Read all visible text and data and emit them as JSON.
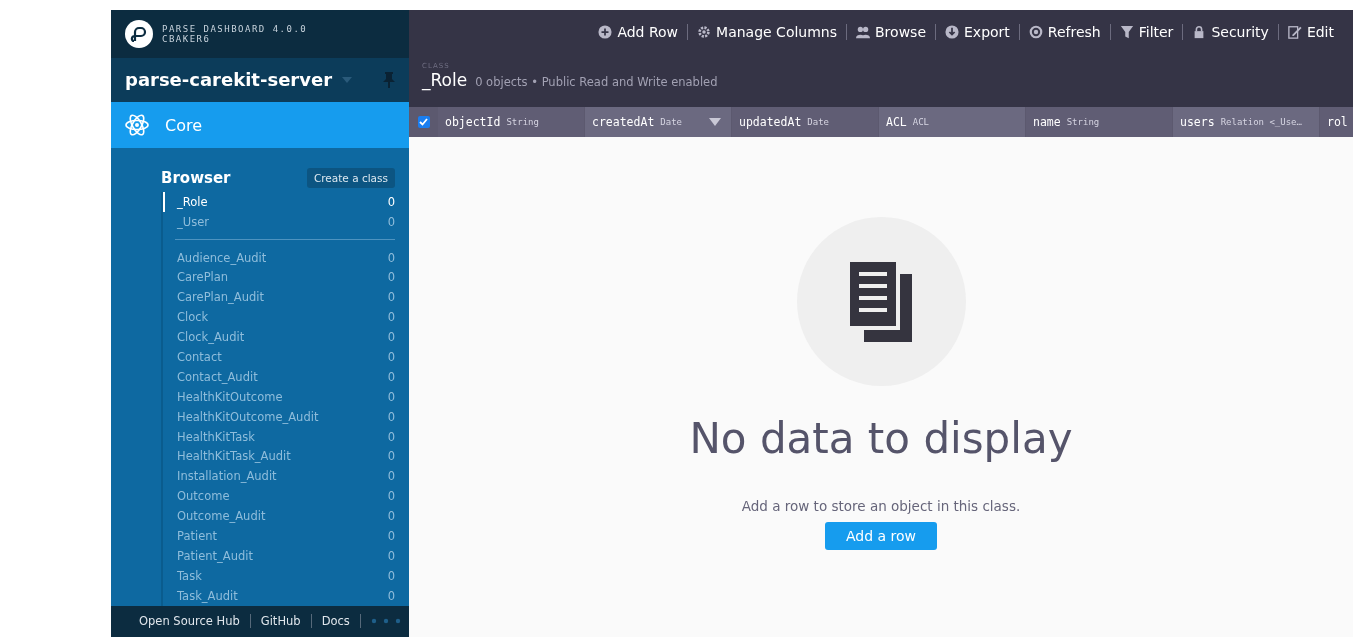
{
  "brand": {
    "title": "PARSE DASHBOARD 4.0.0",
    "user": "CBAKER6"
  },
  "app_selector": {
    "name": "parse-carekit-server"
  },
  "section": {
    "label": "Core",
    "selected": true
  },
  "browser": {
    "title": "Browser",
    "create_button": "Create a class",
    "system_classes": [
      {
        "name": "_Role",
        "count": "0",
        "selected": true
      },
      {
        "name": "_User",
        "count": "0",
        "selected": false
      }
    ],
    "classes": [
      {
        "name": "Audience_Audit",
        "count": "0",
        "selected": false
      },
      {
        "name": "CarePlan",
        "count": "0",
        "selected": false
      },
      {
        "name": "CarePlan_Audit",
        "count": "0",
        "selected": false
      },
      {
        "name": "Clock",
        "count": "0",
        "selected": false
      },
      {
        "name": "Clock_Audit",
        "count": "0",
        "selected": false
      },
      {
        "name": "Contact",
        "count": "0",
        "selected": false
      },
      {
        "name": "Contact_Audit",
        "count": "0",
        "selected": false
      },
      {
        "name": "HealthKitOutcome",
        "count": "0",
        "selected": false
      },
      {
        "name": "HealthKitOutcome_Audit",
        "count": "0",
        "selected": false
      },
      {
        "name": "HealthKitTask",
        "count": "0",
        "selected": false
      },
      {
        "name": "HealthKitTask_Audit",
        "count": "0",
        "selected": false
      },
      {
        "name": "Installation_Audit",
        "count": "0",
        "selected": false
      },
      {
        "name": "Outcome",
        "count": "0",
        "selected": false
      },
      {
        "name": "Outcome_Audit",
        "count": "0",
        "selected": false
      },
      {
        "name": "Patient",
        "count": "0",
        "selected": false
      },
      {
        "name": "Patient_Audit",
        "count": "0",
        "selected": false
      },
      {
        "name": "Task",
        "count": "0",
        "selected": false
      },
      {
        "name": "Task_Audit",
        "count": "0",
        "selected": false
      }
    ]
  },
  "footer_links": [
    "Open Source Hub",
    "GitHub",
    "Docs"
  ],
  "toolbar": [
    {
      "kind": "add",
      "label": "Add Row"
    },
    {
      "kind": "gear",
      "label": "Manage Columns"
    },
    {
      "kind": "people",
      "label": "Browse"
    },
    {
      "kind": "download",
      "label": "Export"
    },
    {
      "kind": "refresh",
      "label": "Refresh"
    },
    {
      "kind": "filter",
      "label": "Filter"
    },
    {
      "kind": "lock",
      "label": "Security"
    },
    {
      "kind": "edit",
      "label": "Edit"
    }
  ],
  "class_header": {
    "caption": "CLASS",
    "name": "_Role",
    "details": "0 objects • Public Read and Write enabled"
  },
  "table": {
    "select_all_checked": true,
    "columns": [
      {
        "name": "objectId",
        "type": "String",
        "sorted": false
      },
      {
        "name": "createdAt",
        "type": "Date",
        "sorted": true
      },
      {
        "name": "updatedAt",
        "type": "Date",
        "sorted": false
      },
      {
        "name": "ACL",
        "type": "ACL",
        "sorted": false
      },
      {
        "name": "name",
        "type": "String",
        "sorted": false
      },
      {
        "name": "users",
        "type": "Relation <_Use…",
        "sorted": false
      },
      {
        "name": "rol",
        "sorted": false
      }
    ]
  },
  "empty_state": {
    "title": "No data to display",
    "message": "Add a row to store an object in this class.",
    "button": "Add a row"
  }
}
